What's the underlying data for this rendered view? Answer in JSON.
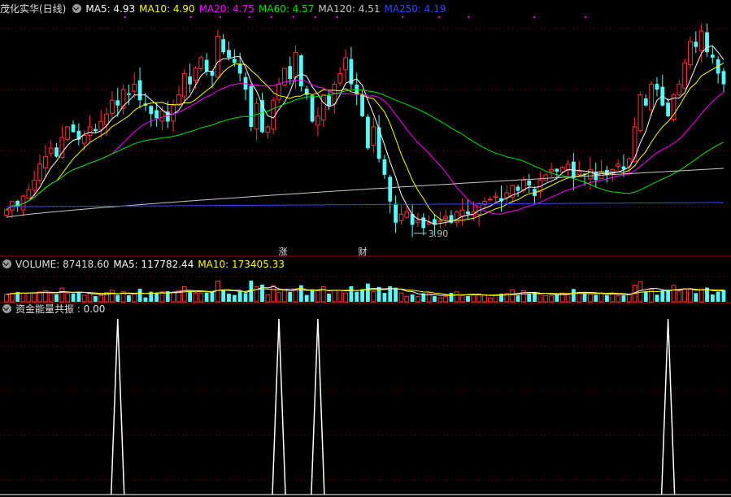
{
  "header": {
    "title": "茂化实华(日线)",
    "ma5": "MA5: 4.93",
    "ma10": "MA10: 4.90",
    "ma20": "MA20: 4.75",
    "ma60": "MA60: 4.57",
    "ma120": "MA120: 4.51",
    "ma250": "MA250: 4.19"
  },
  "volume_legend": {
    "label": "VOLUME: 87418.60",
    "ma5": "MA5: 117782.44",
    "ma10": "MA10: 173405.33"
  },
  "indicator_legend": {
    "label": "资金能量共振 : 0.00"
  },
  "annotations": {
    "low_label": "3.90",
    "tag_zhang": "涨",
    "tag_cai": "财"
  },
  "colors": {
    "up": "#ff3232",
    "down": "#54fcfc",
    "ma5": "#ffffff",
    "ma10": "#ffff00",
    "ma20": "#ff00ff",
    "ma60": "#00e600",
    "ma120": "#c8c8c8",
    "ma250": "#2f4bff",
    "grid": "#8b0000"
  },
  "chart_data": [
    {
      "type": "candlestick",
      "title": "茂化实华(日线)",
      "ylim": [
        3.8,
        5.9
      ],
      "series_names": [
        "MA5",
        "MA10",
        "MA20",
        "MA60",
        "MA120",
        "MA250"
      ],
      "closes": [
        4.12,
        4.2,
        4.15,
        4.25,
        4.31,
        4.4,
        4.55,
        4.62,
        4.7,
        4.62,
        4.8,
        4.9,
        4.85,
        4.78,
        4.82,
        4.9,
        4.86,
        4.95,
        5.02,
        5.15,
        5.1,
        5.25,
        5.2,
        5.3,
        5.15,
        5.1,
        5.02,
        4.98,
        5.05,
        4.95,
        5.1,
        5.2,
        5.4,
        5.3,
        5.45,
        5.55,
        5.42,
        5.38,
        5.75,
        5.6,
        5.55,
        5.5,
        5.4,
        5.25,
        4.9,
        5.12,
        4.85,
        4.9,
        5.15,
        5.3,
        5.45,
        5.35,
        5.6,
        5.28,
        5.2,
        4.95,
        5.0,
        5.2,
        5.1,
        5.3,
        5.4,
        5.55,
        5.3,
        5.2,
        5.0,
        4.7,
        4.9,
        4.6,
        4.45,
        4.2,
        4.0,
        4.08,
        4.1,
        3.98,
        4.02,
        3.95,
        4.0,
        3.98,
        4.02,
        4.06,
        4.0,
        4.1,
        4.12,
        4.08,
        4.1,
        4.18,
        4.2,
        4.22,
        4.25,
        4.2,
        4.28,
        4.35,
        4.3,
        4.4,
        4.35,
        4.25,
        4.4,
        4.45,
        4.5,
        4.48,
        4.52,
        4.55,
        4.42,
        4.48,
        4.45,
        4.5,
        4.4,
        4.48,
        4.45,
        4.5,
        4.55,
        4.5,
        4.6,
        4.9,
        5.2,
        5.1,
        5.3,
        5.25,
        5.1,
        5.0,
        5.2,
        5.3,
        5.5,
        5.7,
        5.65,
        5.8,
        5.6,
        5.55,
        5.4,
        5.3
      ],
      "last_ma": {
        "MA5": 4.93,
        "MA10": 4.9,
        "MA20": 4.75,
        "MA60": 4.57,
        "MA120": 4.51,
        "MA250": 4.19
      },
      "low_marker": 3.9
    },
    {
      "type": "bar",
      "title": "VOLUME",
      "series_names": [
        "VOLUME",
        "MA5",
        "MA10"
      ],
      "last": {
        "VOLUME": 87418.6,
        "MA5": 117782.44,
        "MA10": 173405.33
      }
    },
    {
      "type": "line",
      "title": "资金能量共振",
      "value": 0.0,
      "spike_bars": [
        20,
        49,
        56,
        119
      ]
    }
  ]
}
